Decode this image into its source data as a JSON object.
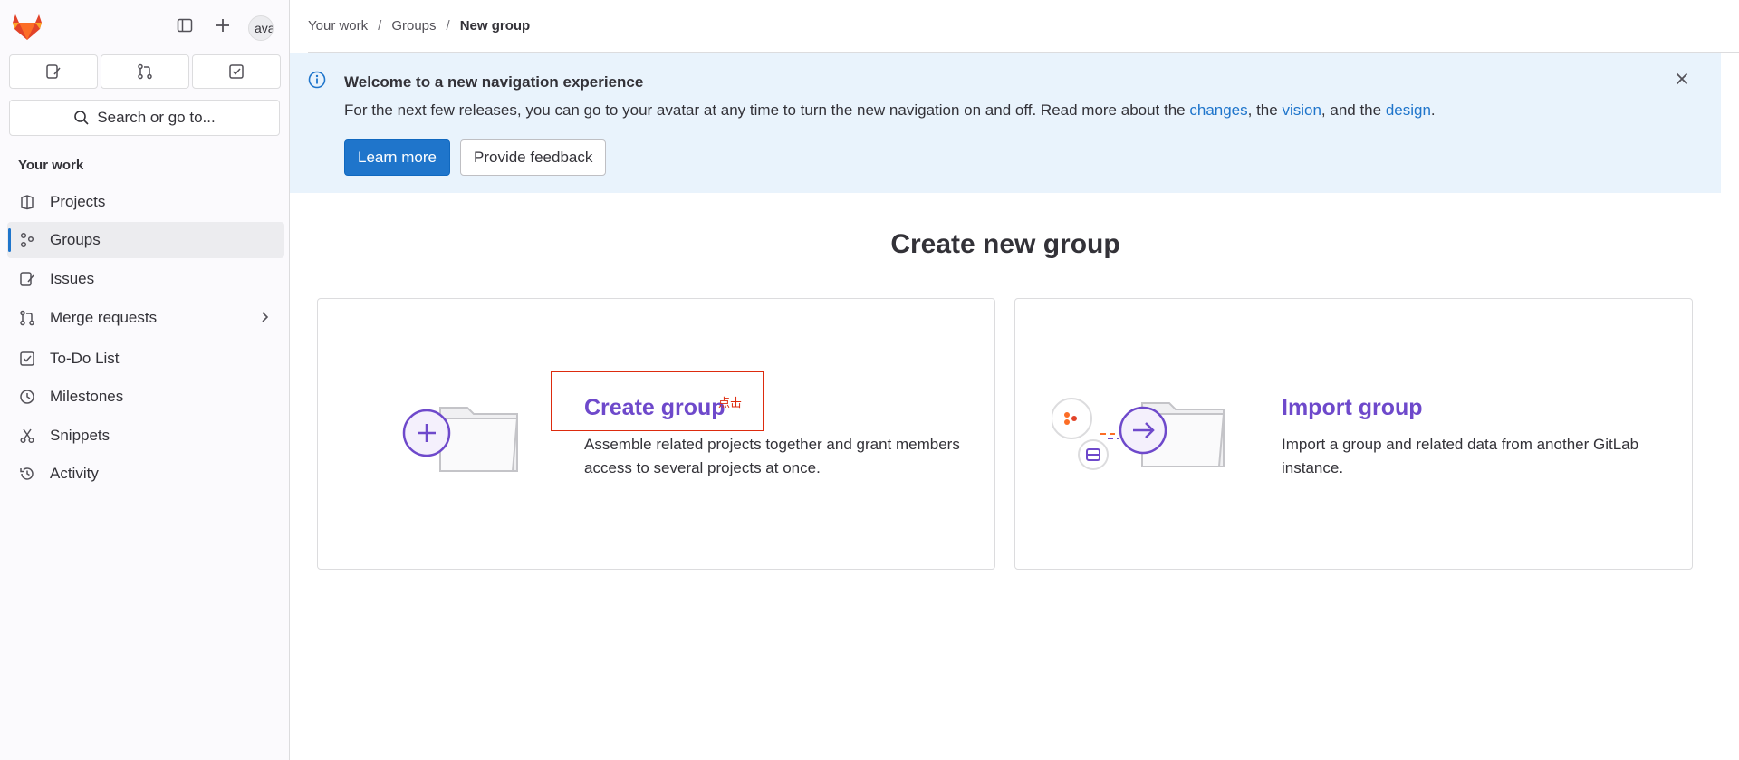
{
  "sidebar": {
    "avatar_text": "avatar",
    "search_label": "Search or go to...",
    "section_label": "Your work",
    "items": [
      {
        "label": "Projects"
      },
      {
        "label": "Groups"
      },
      {
        "label": "Issues"
      },
      {
        "label": "Merge requests"
      },
      {
        "label": "To-Do List"
      },
      {
        "label": "Milestones"
      },
      {
        "label": "Snippets"
      },
      {
        "label": "Activity"
      }
    ]
  },
  "breadcrumb": {
    "items": [
      "Your work",
      "Groups",
      "New group"
    ],
    "separator": "/"
  },
  "banner": {
    "title": "Welcome to a new navigation experience",
    "text_prefix": "For the next few releases, you can go to your avatar at any time to turn the new navigation on and off. Read more about the ",
    "link_changes": "changes",
    "text_mid1": ", the ",
    "link_vision": "vision",
    "text_mid2": ", and the ",
    "link_design": "design",
    "text_suffix": ".",
    "learn_more": "Learn more",
    "feedback": "Provide feedback"
  },
  "main": {
    "title": "Create new group",
    "create_card": {
      "title": "Create group",
      "description": "Assemble related projects together and grant members access to several projects at once.",
      "annotation": "点击"
    },
    "import_card": {
      "title": "Import group",
      "description": "Import a group and related data from another GitLab instance."
    }
  },
  "colors": {
    "accent": "#1f75cb",
    "purple": "#6e49cb",
    "banner_bg": "#e9f3fc",
    "highlight": "#dd2b0e"
  }
}
